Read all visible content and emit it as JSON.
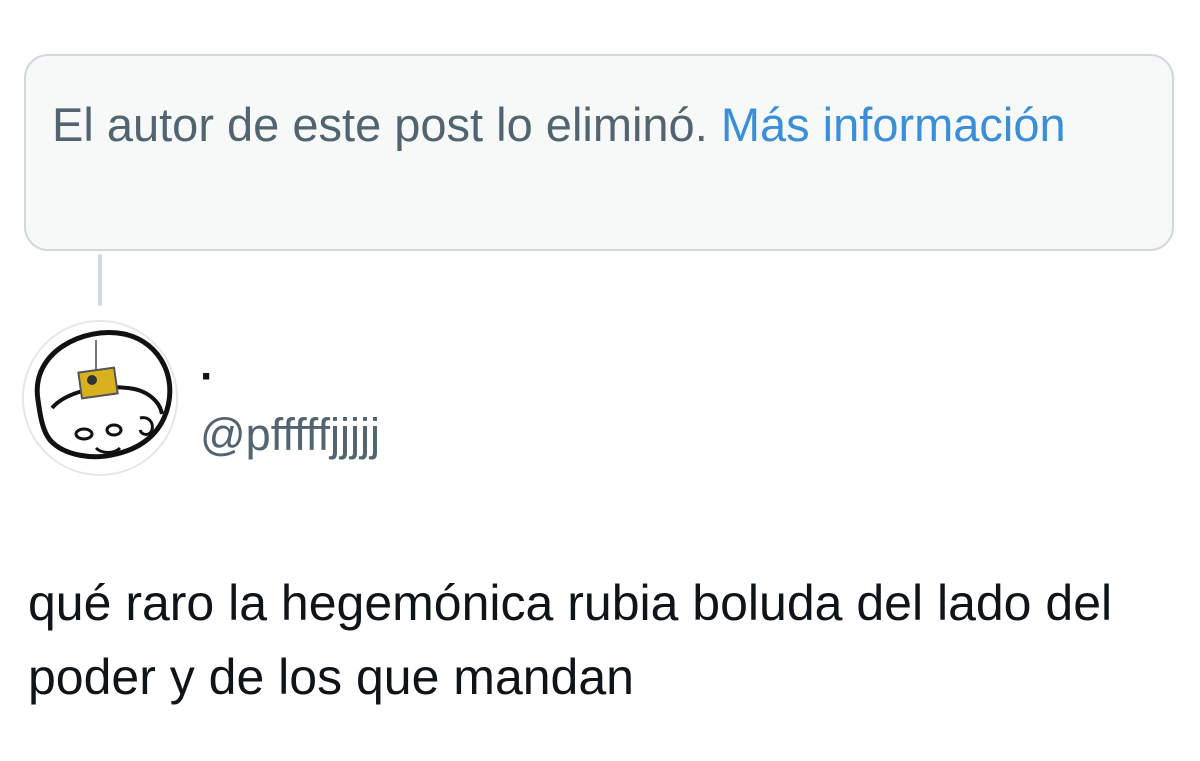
{
  "quoted_post": {
    "deleted_message": "El autor de este post lo eliminó.",
    "more_info_link": "Más información"
  },
  "author": {
    "display_name": "·",
    "handle": "@pfffffjjjjj",
    "avatar_icon": "meme-face-avatar"
  },
  "post": {
    "text": "qué raro la hegemónica rubia boluda del lado del poder y de los que mandan"
  },
  "colors": {
    "link": "#3a8fd8",
    "secondary_text": "#536471",
    "card_background": "#f7f9f9",
    "card_border": "#cfd9de"
  }
}
